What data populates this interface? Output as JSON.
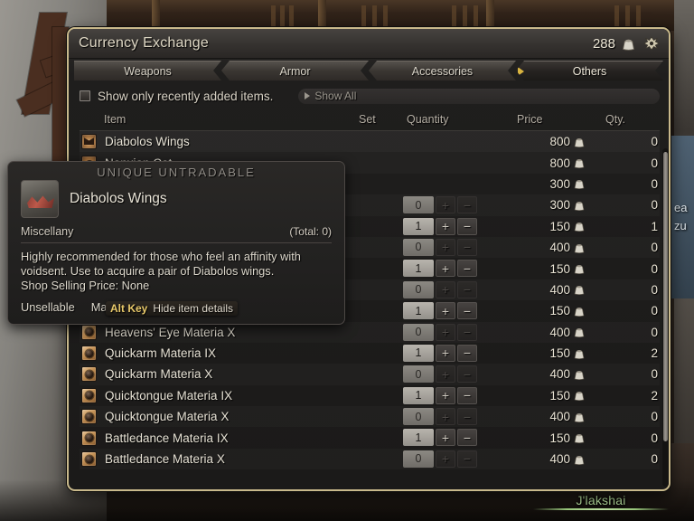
{
  "window": {
    "title": "Currency Exchange",
    "currency_amount": "288",
    "currency_icon": "pouch-icon",
    "close_icon": "close-icon"
  },
  "tabs": [
    {
      "label": "Weapons",
      "active": false
    },
    {
      "label": "Armor",
      "active": false
    },
    {
      "label": "Accessories",
      "active": false
    },
    {
      "label": "Others",
      "active": true
    }
  ],
  "filter": {
    "checkbox_label": "Show only recently added items.",
    "checked": false,
    "show_all_label": "Show All"
  },
  "columns": {
    "item": "Item",
    "set": "Set",
    "quantity": "Quantity",
    "price": "Price",
    "qty": "Qty."
  },
  "rows": [
    {
      "name": "Diabolos Wings",
      "icon": "icon-wings",
      "qty": null,
      "price": "800",
      "have": "0",
      "selected": true
    },
    {
      "name": "Nanxian Cat",
      "icon": "icon-cat",
      "qty": null,
      "price": "800",
      "have": "0"
    },
    {
      "name": "",
      "icon": "icon-materia",
      "qty": null,
      "price": "300",
      "have": "0"
    },
    {
      "name": "",
      "icon": "icon-materia",
      "qty": "0",
      "price": "300",
      "have": "0"
    },
    {
      "name": "",
      "icon": "icon-materia",
      "qty": "1",
      "price": "150",
      "have": "1"
    },
    {
      "name": "",
      "icon": "icon-materia",
      "qty": "0",
      "price": "400",
      "have": "0"
    },
    {
      "name": "",
      "icon": "icon-materia",
      "qty": "1",
      "price": "150",
      "have": "0"
    },
    {
      "name": "",
      "icon": "icon-materia",
      "qty": "0",
      "price": "400",
      "have": "0"
    },
    {
      "name": "",
      "icon": "icon-materia",
      "qty": "1",
      "price": "150",
      "have": "0"
    },
    {
      "name": "Heavens' Eye Materia X",
      "icon": "icon-materia",
      "qty": "0",
      "price": "400",
      "have": "0"
    },
    {
      "name": "Quickarm Materia IX",
      "icon": "icon-materia",
      "qty": "1",
      "price": "150",
      "have": "2"
    },
    {
      "name": "Quickarm Materia X",
      "icon": "icon-materia",
      "qty": "0",
      "price": "400",
      "have": "0"
    },
    {
      "name": "Quicktongue Materia IX",
      "icon": "icon-materia",
      "qty": "1",
      "price": "150",
      "have": "2"
    },
    {
      "name": "Quicktongue Materia X",
      "icon": "icon-materia",
      "qty": "0",
      "price": "400",
      "have": "0"
    },
    {
      "name": "Battledance Materia IX",
      "icon": "icon-materia",
      "qty": "1",
      "price": "150",
      "have": "0"
    },
    {
      "name": "Battledance Materia X",
      "icon": "icon-materia",
      "qty": "0",
      "price": "400",
      "have": "0"
    }
  ],
  "stepper": {
    "plus": "+",
    "minus": "−"
  },
  "tooltip": {
    "flags_top": "UNIQUE   UNTRADABLE",
    "name": "Diabolos Wings",
    "category": "Miscellany",
    "total": "(Total: 0)",
    "description": "Highly recommended for those who feel an affinity with voidsent. Use to acquire a pair of Diabolos wings.",
    "shop_price": "Shop Selling Price: None",
    "flag_unsellable": "Unsellable",
    "flag_market": "Market Prohibited"
  },
  "hide_hint": {
    "key": "Alt Key",
    "text": "Hide item details"
  },
  "background": {
    "npc_name": "J'lakshai",
    "hidden_text_1": "ea",
    "hidden_text_2": "zu"
  },
  "colors": {
    "window_border": "#c9b98b",
    "accent_gold": "#d9b440",
    "npc_green": "#b9e0a0",
    "text_primary": "#e6e1d4",
    "text_muted": "#9b968d"
  }
}
